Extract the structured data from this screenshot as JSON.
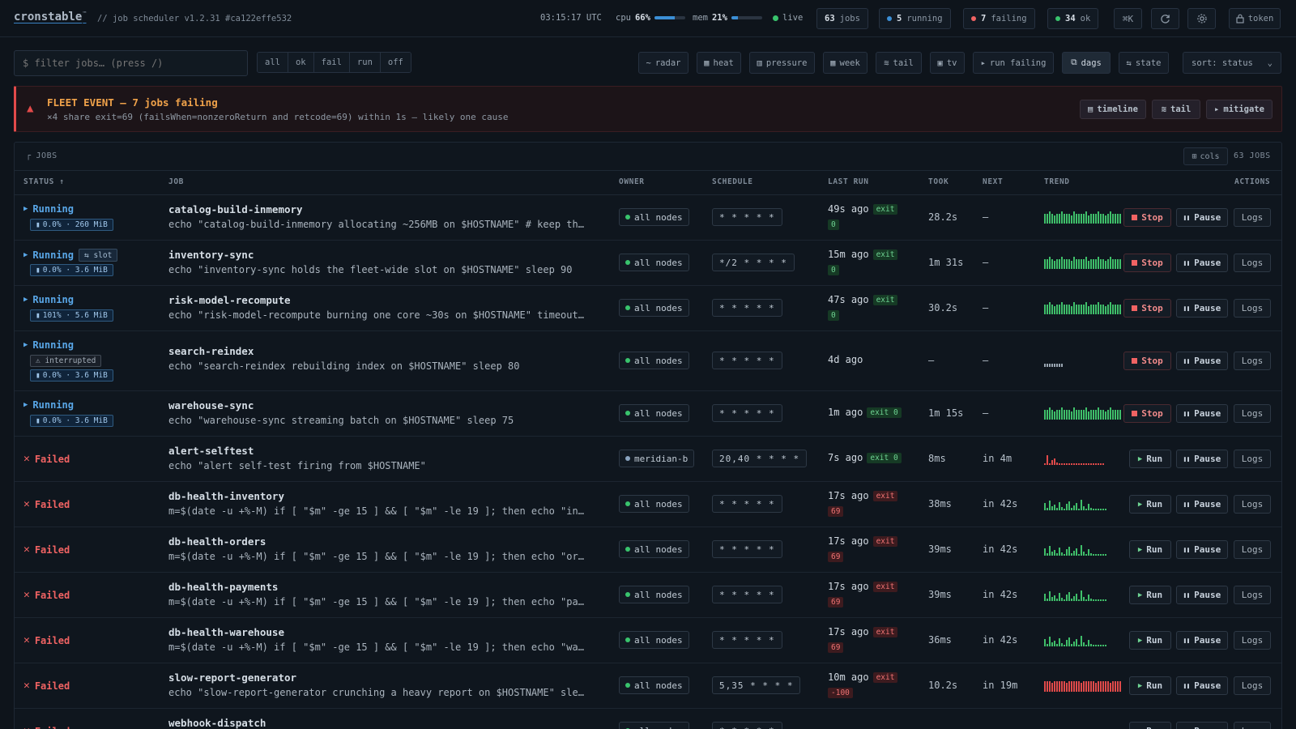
{
  "app": {
    "logo": "cronstable",
    "logo_tm": "™",
    "tagline": "// job scheduler  v1.2.31  #ca122effe532"
  },
  "top": {
    "clock": "03:15:17 UTC",
    "cpu_label": "cpu",
    "cpu_value": "66%",
    "cpu_fraction": 0.66,
    "mem_label": "mem",
    "mem_value": "21%",
    "mem_fraction": 0.21,
    "live_label": "live",
    "jobs_count": "63",
    "jobs_label": "jobs",
    "running_count": "5",
    "running_label": "running",
    "failing_count": "7",
    "failing_label": "failing",
    "ok_count": "34",
    "ok_label": "ok",
    "shortcut_label": "⌘K",
    "token_label": "token"
  },
  "toolbar": {
    "filter_placeholder": "$ filter jobs… (press /)",
    "segments": [
      "all",
      "ok",
      "fail",
      "run",
      "off"
    ],
    "tools": [
      {
        "icon": "∼",
        "label": "radar"
      },
      {
        "icon": "▦",
        "label": "heat"
      },
      {
        "icon": "▥",
        "label": "pressure"
      },
      {
        "icon": "▦",
        "label": "week"
      },
      {
        "icon": "≋",
        "label": "tail"
      },
      {
        "icon": "▣",
        "label": "tv"
      },
      {
        "icon": "▸",
        "label": "run failing"
      },
      {
        "icon": "⧉",
        "label": "dags"
      },
      {
        "icon": "⇆",
        "label": "state"
      }
    ],
    "sort_label": "sort: status"
  },
  "alert": {
    "title": "FLEET EVENT — 7 jobs failing",
    "subtitle": "×4 share exit=69 (failsWhen=nonzeroReturn and retcode=69) within 1s — likely one cause",
    "buttons": [
      {
        "icon": "▤",
        "label": "timeline"
      },
      {
        "icon": "≋",
        "label": "tail"
      },
      {
        "icon": "▸",
        "label": "mitigate"
      }
    ]
  },
  "panel": {
    "title": "JOBS",
    "cols_label": "cols",
    "count_label": "63 JOBS"
  },
  "headers": {
    "status": "STATUS ↑",
    "job": "JOB",
    "owner": "OWNER",
    "schedule": "SCHEDULE",
    "last_run": "LAST RUN",
    "took": "TOOK",
    "next": "NEXT",
    "trend": "TREND",
    "actions": "ACTIONS"
  },
  "actions": {
    "stop": "Stop",
    "pause": "Pause",
    "logs": "Logs",
    "run": "Run"
  },
  "colors": {
    "accent": "#3b8fd6",
    "fail": "#f06363",
    "ok": "#6ed392",
    "warn": "#f0a24a"
  },
  "rows": [
    {
      "state": "running",
      "status": "Running",
      "resource": "0.0% · 260 MiB",
      "name": "catalog-build-inmemory",
      "cmd": "echo \"catalog-build-inmemory allocating ~256MB on $HOSTNAME\" # keep th…",
      "owner": "all nodes",
      "schedule": "* * * * *",
      "last": "49s ago",
      "exit": "exit 0",
      "exit_ok": true,
      "exit_wrap": true,
      "took": "28.2s",
      "next": "—",
      "trend": "full-green"
    },
    {
      "state": "running",
      "status": "Running",
      "tag": "⇆ slot",
      "resource": "0.0% · 3.6 MiB",
      "name": "inventory-sync",
      "cmd": "echo \"inventory-sync holds the fleet-wide slot on $HOSTNAME\" sleep 90",
      "owner": "all nodes",
      "schedule": "*/2 * * * *",
      "last": "15m ago",
      "exit": "exit 0",
      "exit_ok": true,
      "exit_wrap": true,
      "took": "1m 31s",
      "next": "—",
      "trend": "full-green"
    },
    {
      "state": "running",
      "status": "Running",
      "resource": "101% · 5.6 MiB",
      "name": "risk-model-recompute",
      "cmd": "echo \"risk-model-recompute burning one core ~30s on $HOSTNAME\" timeout…",
      "owner": "all nodes",
      "schedule": "* * * * *",
      "last": "47s ago",
      "exit": "exit 0",
      "exit_ok": true,
      "exit_wrap": true,
      "took": "30.2s",
      "next": "—",
      "trend": "full-green"
    },
    {
      "state": "running",
      "status": "Running",
      "interrupted": "⚠ interrupted",
      "resource": "0.0% · 3.6 MiB",
      "name": "search-reindex",
      "cmd": "echo \"search-reindex rebuilding index on $HOSTNAME\" sleep 80",
      "owner": "all nodes",
      "schedule": "* * * * *",
      "last": "4d ago",
      "exit": "",
      "took": "—",
      "next": "—",
      "trend": "tiny"
    },
    {
      "state": "running",
      "status": "Running",
      "resource": "0.0% · 3.6 MiB",
      "name": "warehouse-sync",
      "cmd": "echo \"warehouse-sync streaming batch on $HOSTNAME\" sleep 75",
      "owner": "all nodes",
      "schedule": "* * * * *",
      "last": "1m ago",
      "exit": "exit 0",
      "exit_ok": true,
      "exit_wrap": false,
      "took": "1m 15s",
      "next": "—",
      "trend": "full-green"
    },
    {
      "state": "failed",
      "status": "Failed",
      "name": "alert-selftest",
      "cmd": "echo \"alert self-test firing from $HOSTNAME\"",
      "owner": "meridian-b",
      "schedule": "20,40 * * * *",
      "last": "7s ago",
      "exit": "exit 0",
      "exit_ok": true,
      "exit_wrap": false,
      "took": "8ms",
      "next": "in 4m",
      "trend": "red-spike"
    },
    {
      "state": "failed",
      "status": "Failed",
      "name": "db-health-inventory",
      "cmd": "m=$(date -u +%-M) if [ \"$m\" -ge 15 ] && [ \"$m\" -le 19 ]; then echo \"in…",
      "owner": "all nodes",
      "schedule": "* * * * *",
      "last": "17s ago",
      "exit": "exit 69",
      "exit_ok": false,
      "exit_wrap": true,
      "took": "38ms",
      "next": "in 42s",
      "trend": "mixed-green"
    },
    {
      "state": "failed",
      "status": "Failed",
      "name": "db-health-orders",
      "cmd": "m=$(date -u +%-M) if [ \"$m\" -ge 15 ] && [ \"$m\" -le 19 ]; then echo \"or…",
      "owner": "all nodes",
      "schedule": "* * * * *",
      "last": "17s ago",
      "exit": "exit 69",
      "exit_ok": false,
      "exit_wrap": true,
      "took": "39ms",
      "next": "in 42s",
      "trend": "mixed-green"
    },
    {
      "state": "failed",
      "status": "Failed",
      "name": "db-health-payments",
      "cmd": "m=$(date -u +%-M) if [ \"$m\" -ge 15 ] && [ \"$m\" -le 19 ]; then echo \"pa…",
      "owner": "all nodes",
      "schedule": "* * * * *",
      "last": "17s ago",
      "exit": "exit 69",
      "exit_ok": false,
      "exit_wrap": true,
      "took": "39ms",
      "next": "in 42s",
      "trend": "mixed-green"
    },
    {
      "state": "failed",
      "status": "Failed",
      "name": "db-health-warehouse",
      "cmd": "m=$(date -u +%-M) if [ \"$m\" -ge 15 ] && [ \"$m\" -le 19 ]; then echo \"wa…",
      "owner": "all nodes",
      "schedule": "* * * * *",
      "last": "17s ago",
      "exit": "exit 69",
      "exit_ok": false,
      "exit_wrap": true,
      "took": "36ms",
      "next": "in 42s",
      "trend": "mixed-green"
    },
    {
      "state": "failed",
      "status": "Failed",
      "name": "slow-report-generator",
      "cmd": "echo \"slow-report-generator crunching a heavy report on $HOSTNAME\" sle…",
      "owner": "all nodes",
      "schedule": "5,35 * * * *",
      "last": "10m ago",
      "exit": "exit -100",
      "exit_ok": false,
      "exit_wrap": true,
      "took": "10.2s",
      "next": "in 19m",
      "trend": "full-red"
    },
    {
      "state": "failed",
      "status": "Failed",
      "name": "webhook-dispatch",
      "cmd": "",
      "owner": "all nodes",
      "schedule": "* * * * *",
      "last": "",
      "exit": "",
      "took": "",
      "next": "",
      "trend": "partial"
    }
  ]
}
